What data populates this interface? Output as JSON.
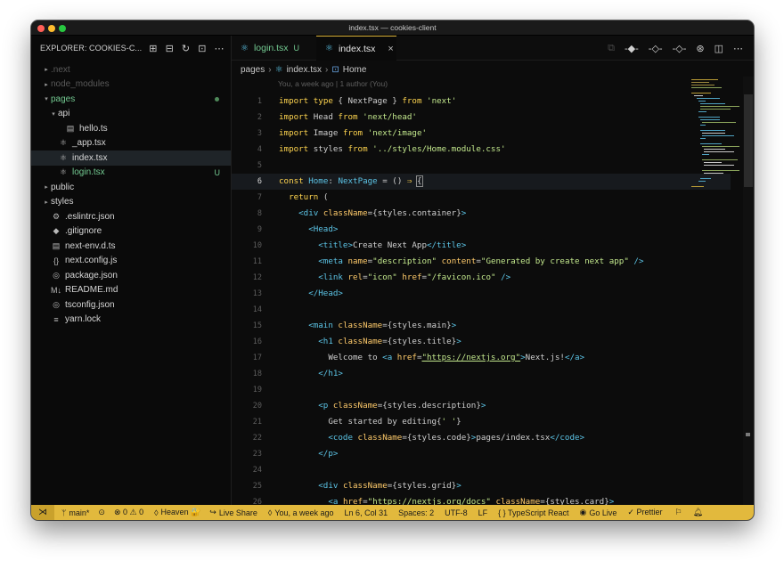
{
  "window": {
    "title": "index.tsx — cookies-client"
  },
  "explorer": {
    "title": "EXPLORER: COOKIES-C...",
    "items": [
      {
        "label": ".next",
        "arrow": "▸",
        "icon": "",
        "indent": 0,
        "style": "dim"
      },
      {
        "label": "node_modules",
        "arrow": "▸",
        "icon": "",
        "indent": 0,
        "style": "dim"
      },
      {
        "label": "pages",
        "arrow": "▾",
        "icon": "",
        "indent": 0,
        "style": "green",
        "dot": true
      },
      {
        "label": "api",
        "arrow": "▾",
        "icon": "",
        "indent": 1,
        "style": ""
      },
      {
        "label": "hello.ts",
        "arrow": "",
        "icon": "▤",
        "indent": 2,
        "style": ""
      },
      {
        "label": "_app.tsx",
        "arrow": "",
        "icon": "⚛",
        "indent": 1,
        "style": ""
      },
      {
        "label": "index.tsx",
        "arrow": "",
        "icon": "⚛",
        "indent": 1,
        "style": "selected"
      },
      {
        "label": "login.tsx",
        "arrow": "",
        "icon": "⚛",
        "indent": 1,
        "style": "green",
        "badge": "U"
      },
      {
        "label": "public",
        "arrow": "▸",
        "icon": "",
        "indent": 0,
        "style": ""
      },
      {
        "label": "styles",
        "arrow": "▸",
        "icon": "",
        "indent": 0,
        "style": ""
      },
      {
        "label": ".eslintrc.json",
        "arrow": "",
        "icon": "⚙",
        "indent": 0,
        "style": ""
      },
      {
        "label": ".gitignore",
        "arrow": "",
        "icon": "◆",
        "indent": 0,
        "style": ""
      },
      {
        "label": "next-env.d.ts",
        "arrow": "",
        "icon": "▤",
        "indent": 0,
        "style": ""
      },
      {
        "label": "next.config.js",
        "arrow": "",
        "icon": "{}",
        "indent": 0,
        "style": ""
      },
      {
        "label": "package.json",
        "arrow": "",
        "icon": "◎",
        "indent": 0,
        "style": ""
      },
      {
        "label": "README.md",
        "arrow": "",
        "icon": "M↓",
        "indent": 0,
        "style": ""
      },
      {
        "label": "tsconfig.json",
        "arrow": "",
        "icon": "◎",
        "indent": 0,
        "style": ""
      },
      {
        "label": "yarn.lock",
        "arrow": "",
        "icon": "≡",
        "indent": 0,
        "style": ""
      }
    ]
  },
  "tabs": [
    {
      "label": "login.tsx",
      "modified": "U"
    },
    {
      "label": "index.tsx",
      "close": "×"
    }
  ],
  "breadcrumb": {
    "folder": "pages",
    "file": "index.tsx",
    "symbol": "Home"
  },
  "blame": "You, a week ago | 1 author (You)",
  "code": [
    {
      "n": "1",
      "html": "<span class='k'>import</span> <span class='k'>type</span> { NextPage } <span class='k'>from</span> <span class='s'>'next'</span>"
    },
    {
      "n": "2",
      "html": "<span class='k'>import</span> Head <span class='k'>from</span> <span class='s'>'next/head'</span>"
    },
    {
      "n": "3",
      "html": "<span class='k'>import</span> Image <span class='k'>from</span> <span class='s'>'next/image'</span>"
    },
    {
      "n": "4",
      "html": "<span class='k'>import</span> styles <span class='k'>from</span> <span class='s'>'../styles/Home.module.css'</span>"
    },
    {
      "n": "5",
      "html": ""
    },
    {
      "n": "6",
      "html": "<span class='k'>const</span> <span class='t'>Home</span>: <span class='t'>NextPage</span> = () <span class='k'>⇒</span> <span class='cursorbox'>{</span>",
      "cur": true
    },
    {
      "n": "7",
      "html": "  <span class='k'>return</span> ("
    },
    {
      "n": "8",
      "html": "    <span class='t'>&lt;div</span> <span class='a'>className</span>={styles.container}<span class='t'>&gt;</span>"
    },
    {
      "n": "9",
      "html": "      <span class='t'>&lt;Head&gt;</span>"
    },
    {
      "n": "10",
      "html": "        <span class='t'>&lt;title&gt;</span>Create Next App<span class='t'>&lt;/title&gt;</span>"
    },
    {
      "n": "11",
      "html": "        <span class='t'>&lt;meta</span> <span class='a'>name</span>=<span class='s'>\"description\"</span> <span class='a'>content</span>=<span class='s'>\"Generated by create next app\"</span> <span class='t'>/&gt;</span>"
    },
    {
      "n": "12",
      "html": "        <span class='t'>&lt;link</span> <span class='a'>rel</span>=<span class='s'>\"icon\"</span> <span class='a'>href</span>=<span class='s'>\"/favicon.ico\"</span> <span class='t'>/&gt;</span>"
    },
    {
      "n": "13",
      "html": "      <span class='t'>&lt;/Head&gt;</span>"
    },
    {
      "n": "14",
      "html": ""
    },
    {
      "n": "15",
      "html": "      <span class='t'>&lt;main</span> <span class='a'>className</span>={styles.main}<span class='t'>&gt;</span>"
    },
    {
      "n": "16",
      "html": "        <span class='t'>&lt;h1</span> <span class='a'>className</span>={styles.title}<span class='t'>&gt;</span>"
    },
    {
      "n": "17",
      "html": "          Welcome to <span class='t'>&lt;a</span> <span class='a'>href</span>=<span class='u'>\"https://nextjs.org\"</span><span class='t'>&gt;</span>Next.js!<span class='t'>&lt;/a&gt;</span>"
    },
    {
      "n": "18",
      "html": "        <span class='t'>&lt;/h1&gt;</span>"
    },
    {
      "n": "19",
      "html": ""
    },
    {
      "n": "20",
      "html": "        <span class='t'>&lt;p</span> <span class='a'>className</span>={styles.description}<span class='t'>&gt;</span>"
    },
    {
      "n": "21",
      "html": "          Get started by editing{<span class='s'>' '</span>}"
    },
    {
      "n": "22",
      "html": "          <span class='t'>&lt;code</span> <span class='a'>className</span>={styles.code}<span class='t'>&gt;</span>pages/index.tsx<span class='t'>&lt;/code&gt;</span>"
    },
    {
      "n": "23",
      "html": "        <span class='t'>&lt;/p&gt;</span>"
    },
    {
      "n": "24",
      "html": ""
    },
    {
      "n": "25",
      "html": "        <span class='t'>&lt;div</span> <span class='a'>className</span>={styles.grid}<span class='t'>&gt;</span>"
    },
    {
      "n": "26",
      "html": "          <span class='t'>&lt;a</span> <span class='a'>href</span>=<span class='u'>\"https://nextjs.org/docs\"</span> <span class='a'>className</span>={styles.card}<span class='t'>&gt;</span>"
    }
  ],
  "status": {
    "remote": "⋊",
    "branch": "main*",
    "sync": "⊙",
    "problems": "⊗ 0 ⚠ 0",
    "heaven": "Heaven 🔐",
    "liveshare": "Live Share",
    "blame": "You, a week ago",
    "position": "Ln 6, Col 31",
    "spaces": "Spaces: 2",
    "encoding": "UTF-8",
    "eol": "LF",
    "language": "{ }  TypeScript React",
    "golive": "Go Live",
    "prettier": "✓ Prettier"
  },
  "colors": {
    "accent": "#e2b93d",
    "green": "#73c991",
    "react": "#5cc4e6"
  }
}
